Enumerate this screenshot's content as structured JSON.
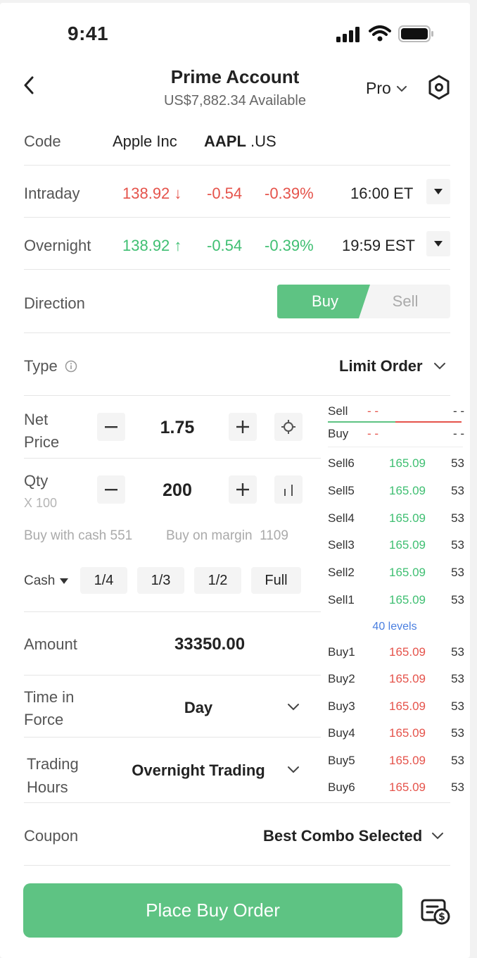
{
  "status_bar": {
    "time": "9:41"
  },
  "header": {
    "title": "Prime Account",
    "subtitle": "US$7,882.34 Available",
    "mode_label": "Pro"
  },
  "code": {
    "label": "Code",
    "name": "Apple Inc",
    "ticker": "AAPL",
    "market": ".US"
  },
  "intraday": {
    "label": "Intraday",
    "price": "138.92",
    "arrow": "↓",
    "change": "-0.54",
    "pct": "-0.39%",
    "time": "16:00 ET"
  },
  "overnight": {
    "label": "Overnight",
    "price": "138.92",
    "arrow": "↑",
    "change": "-0.54",
    "pct": "-0.39%",
    "time": "19:59 EST"
  },
  "direction": {
    "label": "Direction",
    "buy": "Buy",
    "sell": "Sell",
    "selected": "Buy"
  },
  "type": {
    "label": "Type",
    "value": "Limit Order"
  },
  "net_price": {
    "label_line1": "Net",
    "label_line2": "Price",
    "value": "1.75"
  },
  "qty": {
    "label": "Qty",
    "multiplier": "X 100",
    "value": "200"
  },
  "buying_power": {
    "cash": "Buy with cash 551",
    "margin": "Buy on margin  1109"
  },
  "ratio": {
    "account_type": "Cash",
    "options": [
      "1/4",
      "1/3",
      "1/2",
      "Full"
    ]
  },
  "amount": {
    "label": "Amount",
    "value": "33350.00"
  },
  "time_in_force": {
    "label_line1": "Time in",
    "label_line2": "Force",
    "value": "Day"
  },
  "trading_hours": {
    "label_line1": "Trading",
    "label_line2": "Hours",
    "value": "Overnight Trading"
  },
  "coupon": {
    "label": "Coupon",
    "value": "Best Combo Selected"
  },
  "order_book": {
    "top": [
      {
        "label": "Sell",
        "price": "- -",
        "qty": "- -"
      },
      {
        "label": "Buy",
        "price": "- -",
        "qty": "- -"
      }
    ],
    "asks": [
      {
        "label": "Sell6",
        "price": "165.09",
        "qty": "53"
      },
      {
        "label": "Sell5",
        "price": "165.09",
        "qty": "53"
      },
      {
        "label": "Sell4",
        "price": "165.09",
        "qty": "53"
      },
      {
        "label": "Sell3",
        "price": "165.09",
        "qty": "53"
      },
      {
        "label": "Sell2",
        "price": "165.09",
        "qty": "53"
      },
      {
        "label": "Sell1",
        "price": "165.09",
        "qty": "53"
      }
    ],
    "levels_label": "40 levels",
    "bids": [
      {
        "label": "Buy1",
        "price": "165.09",
        "qty": "53"
      },
      {
        "label": "Buy2",
        "price": "165.09",
        "qty": "53"
      },
      {
        "label": "Buy3",
        "price": "165.09",
        "qty": "53"
      },
      {
        "label": "Buy4",
        "price": "165.09",
        "qty": "53"
      },
      {
        "label": "Buy5",
        "price": "165.09",
        "qty": "53"
      },
      {
        "label": "Buy6",
        "price": "165.09",
        "qty": "53"
      }
    ]
  },
  "submit": {
    "label": "Place Buy Order"
  },
  "colors": {
    "buy_green": "#5ec383",
    "up_green": "#3fbf72",
    "down_red": "#e5534b",
    "link_blue": "#4a7fe0"
  },
  "icons": [
    "back-chevron-icon",
    "settings-hexagon-icon",
    "info-icon",
    "minus-icon",
    "plus-icon",
    "target-icon",
    "bars-icon",
    "dropdown-caret-icon",
    "coupon-wallet-icon"
  ]
}
